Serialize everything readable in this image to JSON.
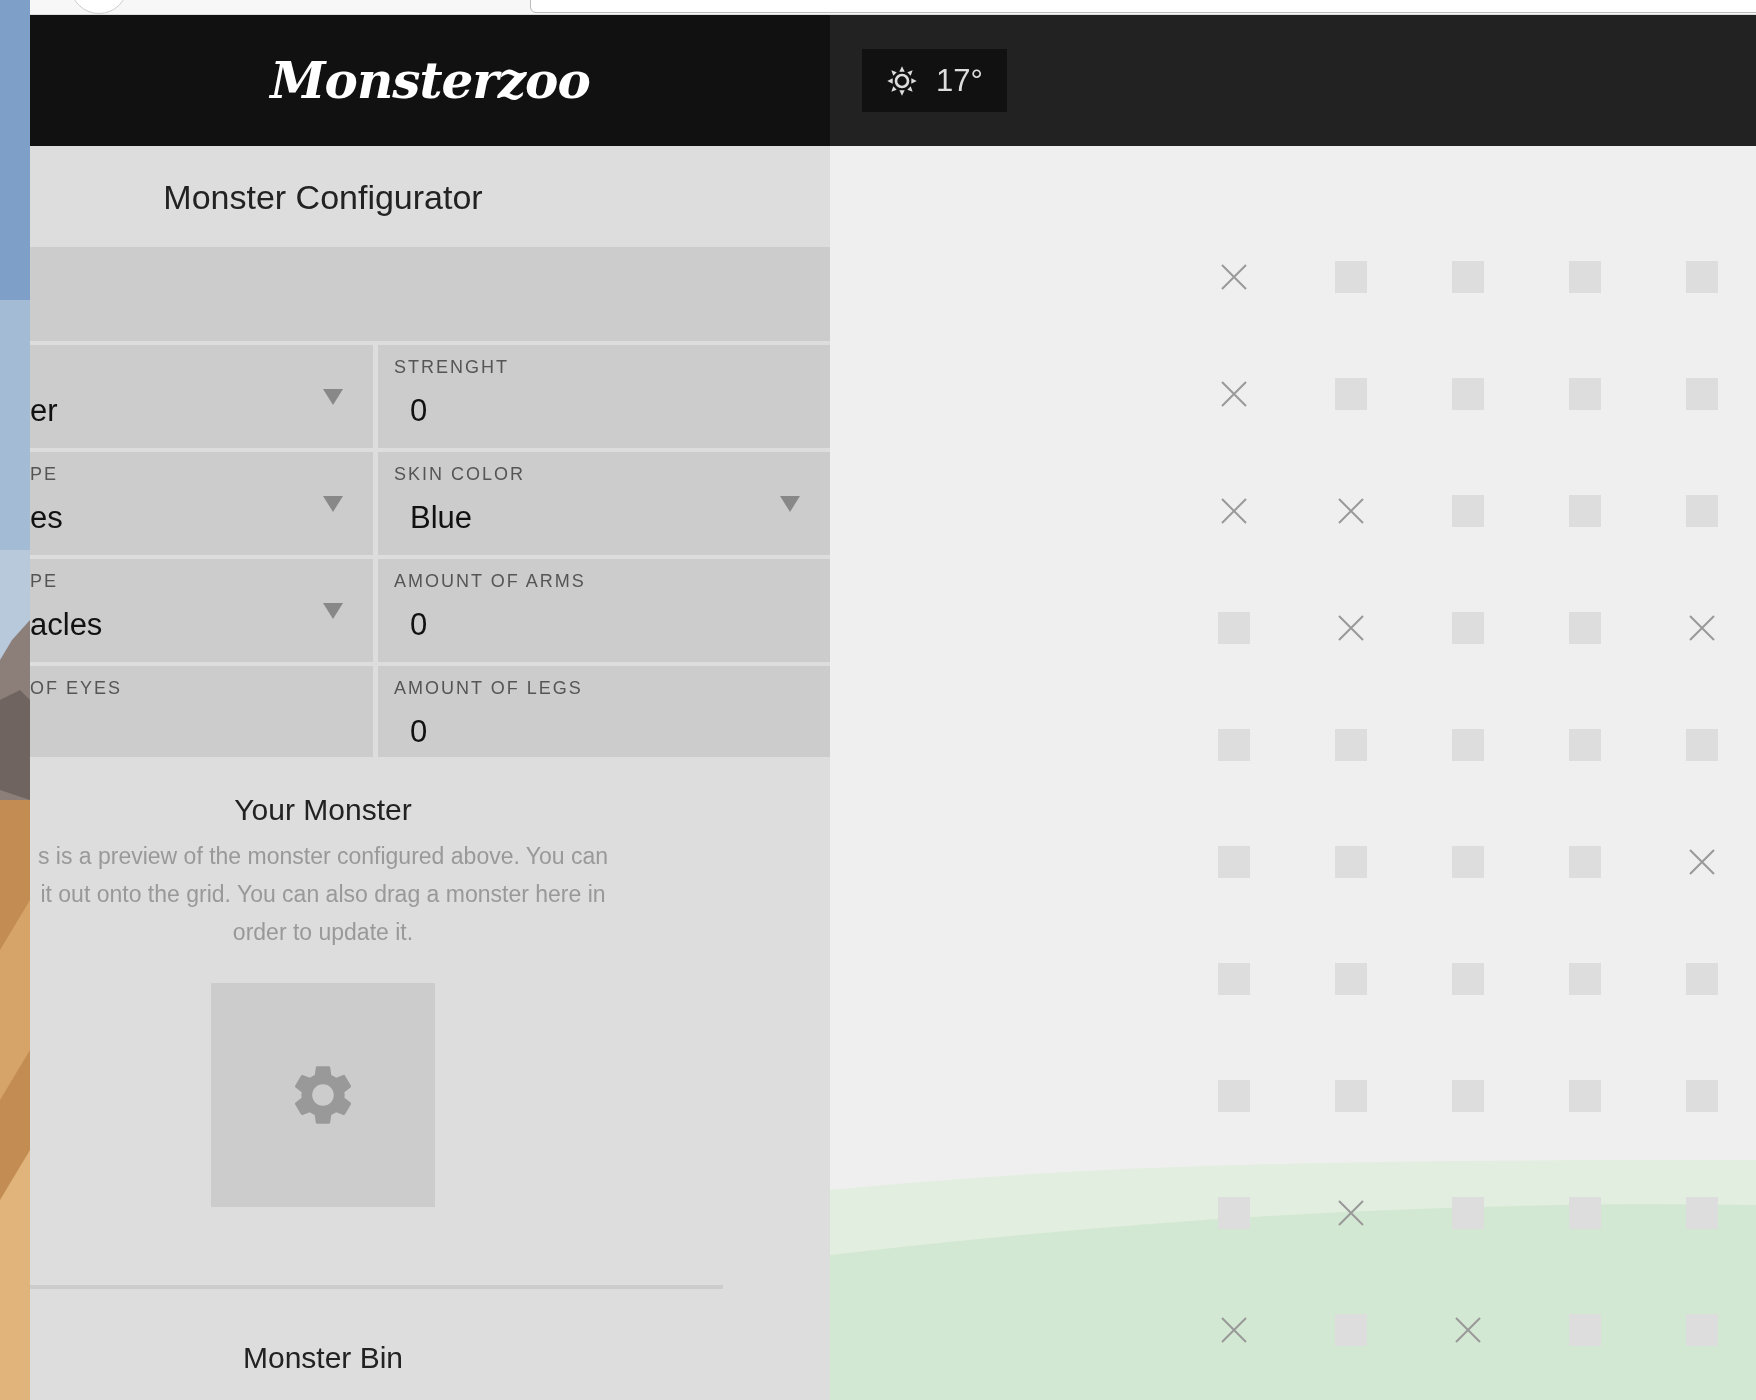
{
  "header": {
    "logo": "Monsterzoo",
    "weather": {
      "temperature": "17°"
    }
  },
  "configurator": {
    "title": "Monster Configurator",
    "field_rows": [
      [
        {
          "value": "er",
          "kind": "select"
        },
        {
          "label": "STRENGHT",
          "value": "0",
          "kind": "number"
        }
      ],
      [
        {
          "label": "PE",
          "value": "es",
          "kind": "select"
        },
        {
          "label": "SKIN COLOR",
          "value": "Blue",
          "kind": "select"
        }
      ],
      [
        {
          "label": "PE",
          "value": "acles",
          "kind": "select"
        },
        {
          "label": "AMOUNT OF ARMS",
          "value": "0",
          "kind": "number"
        }
      ],
      [
        {
          "label": "OF EYES",
          "kind": "number"
        },
        {
          "label": "AMOUNT OF LEGS",
          "value": "0",
          "kind": "number"
        }
      ]
    ]
  },
  "preview": {
    "title": "Your Monster",
    "description": "s is a preview of the monster configured above. You can\nit out onto the grid. You can also drag a monster here in\norder to update it."
  },
  "bin": {
    "title": "Monster Bin"
  },
  "grid": [
    [
      {
        "blocked": true
      },
      {
        "blocked": false
      },
      {
        "blocked": false
      },
      {
        "blocked": false
      },
      {
        "blocked": false
      }
    ],
    [
      {
        "blocked": true
      },
      {
        "blocked": false
      },
      {
        "blocked": false
      },
      {
        "blocked": false
      },
      {
        "blocked": false
      }
    ],
    [
      {
        "blocked": true
      },
      {
        "blocked": true
      },
      {
        "blocked": false
      },
      {
        "blocked": false
      },
      {
        "blocked": false
      }
    ],
    [
      {
        "blocked": false
      },
      {
        "blocked": true
      },
      {
        "blocked": false
      },
      {
        "blocked": false
      },
      {
        "blocked": true
      }
    ],
    [
      {
        "blocked": false
      },
      {
        "blocked": false
      },
      {
        "blocked": false
      },
      {
        "blocked": false
      },
      {
        "blocked": false
      }
    ],
    [
      {
        "blocked": false
      },
      {
        "blocked": false
      },
      {
        "blocked": false
      },
      {
        "blocked": false
      },
      {
        "blocked": true
      }
    ],
    [
      {
        "blocked": false
      },
      {
        "blocked": false
      },
      {
        "blocked": false
      },
      {
        "blocked": false
      },
      {
        "blocked": false
      }
    ],
    [
      {
        "blocked": false
      },
      {
        "blocked": false
      },
      {
        "blocked": false
      },
      {
        "blocked": false
      },
      {
        "blocked": false
      }
    ],
    [
      {
        "blocked": false
      },
      {
        "blocked": true
      },
      {
        "blocked": false
      },
      {
        "blocked": false
      },
      {
        "blocked": false
      }
    ],
    [
      {
        "blocked": true
      },
      {
        "blocked": false
      },
      {
        "blocked": true
      },
      {
        "blocked": false
      },
      {
        "blocked": false
      }
    ]
  ]
}
